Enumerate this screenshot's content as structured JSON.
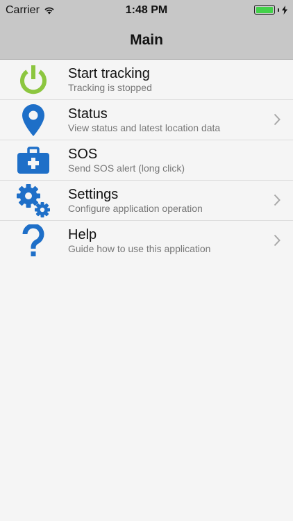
{
  "status_bar": {
    "carrier": "Carrier",
    "time": "1:48 PM"
  },
  "nav": {
    "title": "Main"
  },
  "menu": [
    {
      "title": "Start tracking",
      "subtitle": "Tracking is stopped"
    },
    {
      "title": "Status",
      "subtitle": "View status and latest location data"
    },
    {
      "title": "SOS",
      "subtitle": "Send SOS alert (long click)"
    },
    {
      "title": "Settings",
      "subtitle": "Configure application operation"
    },
    {
      "title": "Help",
      "subtitle": "Guide how to use this application"
    }
  ],
  "colors": {
    "power_green": "#8cc63f",
    "icon_blue": "#1e6fc8",
    "battery_green": "#43d14a"
  },
  "icons": [
    "power-icon",
    "location-pin-icon",
    "first-aid-kit-icon",
    "gears-icon",
    "question-mark-icon",
    "chevron-right-icon"
  ]
}
